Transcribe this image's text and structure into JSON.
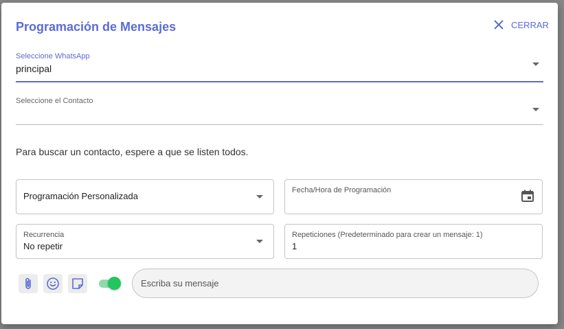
{
  "dialog": {
    "title": "Programación de Mensajes",
    "close_label": "CERRAR"
  },
  "whatsapp_select": {
    "label": "Seleccione WhatsApp",
    "value": "principal"
  },
  "contact_select": {
    "label": "Seleccione el Contacto",
    "value": ""
  },
  "hint_text": "Para buscar un contacto, espere a que se listen todos.",
  "schedule_type": {
    "value": "Programación Personalizada"
  },
  "datetime": {
    "label": "Fecha/Hora de Programación",
    "value": ""
  },
  "recurrence": {
    "label": "Recurrencia",
    "value": "No repetir"
  },
  "repetitions": {
    "label": "Repeticiones (Predeterminado para crear un mensaje: 1)",
    "value": "1"
  },
  "composer": {
    "placeholder": "Escriba su mensaje",
    "toggle_on": true,
    "toggle_color": "#22c55e"
  },
  "colors": {
    "accent": "#5b6bd6"
  },
  "icons": [
    "close-icon",
    "chevron-down-icon",
    "calendar-icon",
    "paperclip-icon",
    "emoji-icon",
    "sticker-icon"
  ]
}
